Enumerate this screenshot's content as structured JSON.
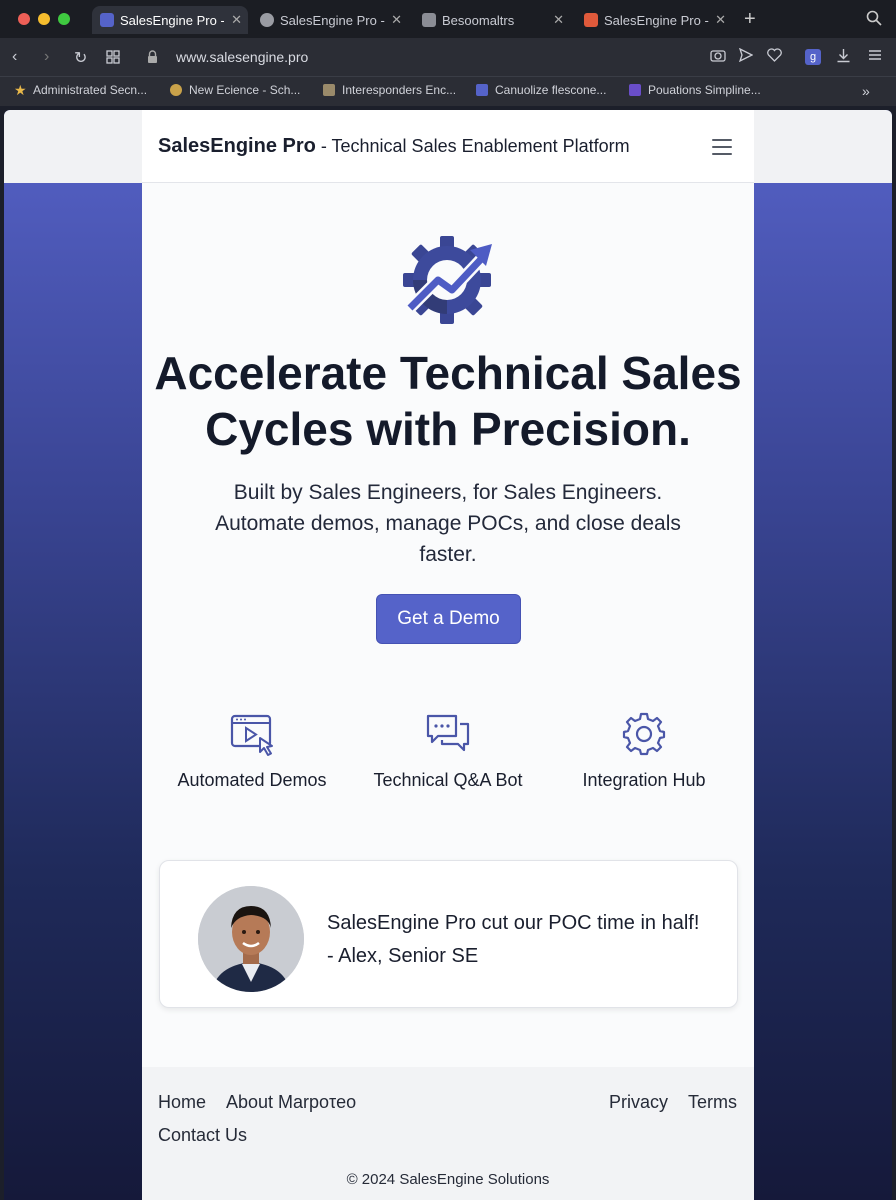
{
  "browser": {
    "tabs": [
      {
        "title": "SalesEngine Pro -",
        "active": true
      },
      {
        "title": "SalesEngine Pro - ",
        "active": false
      },
      {
        "title": "Besoomaltrs",
        "active": false
      },
      {
        "title": "SalesEngine Pro -",
        "active": false
      }
    ],
    "url": "www.salesengine.pro",
    "bookmarks": [
      "Administrated Secn...",
      "New Ecience - Sch...",
      "Interesponders Enc...",
      "Canuolize flescone...",
      "Pouations Simpline..."
    ],
    "bookmarks_overflow": "»",
    "new_tab": "+",
    "extension_badge": "g"
  },
  "site": {
    "brand": "SalesEngine Pro",
    "tagline": " - Technical Sales Enablement Platform",
    "hero_line1": "Accelerate Technical Sales",
    "hero_line2": "Cycles with Precision.",
    "subtitle_line1": "Built by Sales Engineers, for Sales Engineers.",
    "subtitle_line2": "Automate demos, manage POCs, and close deals",
    "subtitle_line3": "faster.",
    "cta": "Get a Demo",
    "features": [
      {
        "label": "Automated Demos",
        "icon": "demo-play-icon"
      },
      {
        "label": "Technical Q&A Bot",
        "icon": "chat-bubbles-icon"
      },
      {
        "label": "Integration Hub",
        "icon": "gear-icon"
      }
    ],
    "testimonial": {
      "quote": "SalesEngine Pro cut our POC time in half!",
      "author": "- Alex, Senior SE"
    },
    "footer": {
      "home": "Home",
      "about": "About Marpoτeo",
      "contact": "Contact Us",
      "privacy": "Privacy",
      "terms": "Terms",
      "copyright": "© 2024 SalesEngine Solutions"
    }
  },
  "colors": {
    "accent": "#5563c9",
    "background_gradient_top": "#5662c8",
    "background_gradient_bottom": "#15193a"
  }
}
